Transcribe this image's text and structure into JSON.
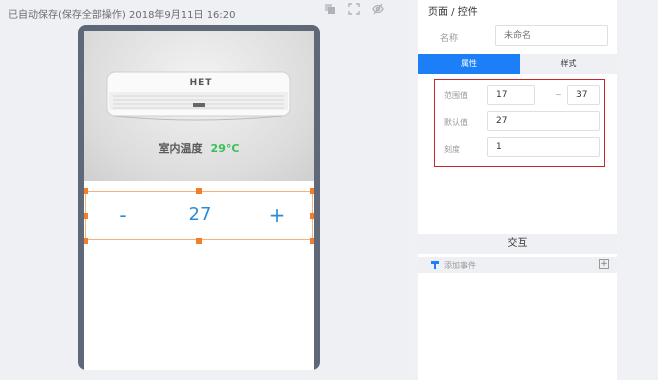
{
  "status": {
    "save_text": "已自动保存(保存全部操作) 2018年9月11日 16:20"
  },
  "toolbar": {
    "icons": [
      "layers-icon",
      "fullscreen-icon",
      "eye-hidden-icon"
    ]
  },
  "preview": {
    "brand": "HET",
    "room_temp_label": "室内温度",
    "room_temp_value": "29°C",
    "stepper": {
      "minus": "-",
      "value": "27",
      "plus": "+"
    },
    "accent_color": "#2a8cd8",
    "temp_color": "#35c15a",
    "selection_color": "#f37e2a"
  },
  "panel": {
    "title": "页面 / 控件",
    "name_label": "名称",
    "name_placeholder": "未命名",
    "tabs": [
      {
        "label": "属性",
        "active": true
      },
      {
        "label": "样式",
        "active": false
      }
    ],
    "props": {
      "range_label": "范围值",
      "range_min": "17",
      "range_sep": "~",
      "range_max": "37",
      "default_label": "默认值",
      "default_value": "27",
      "step_label": "刻度",
      "step_value": "1"
    },
    "interaction_title": "交互",
    "add_event_label": "添加事件",
    "active_tab_color": "#1d7ff8",
    "highlight_border_color": "#c9252c"
  }
}
